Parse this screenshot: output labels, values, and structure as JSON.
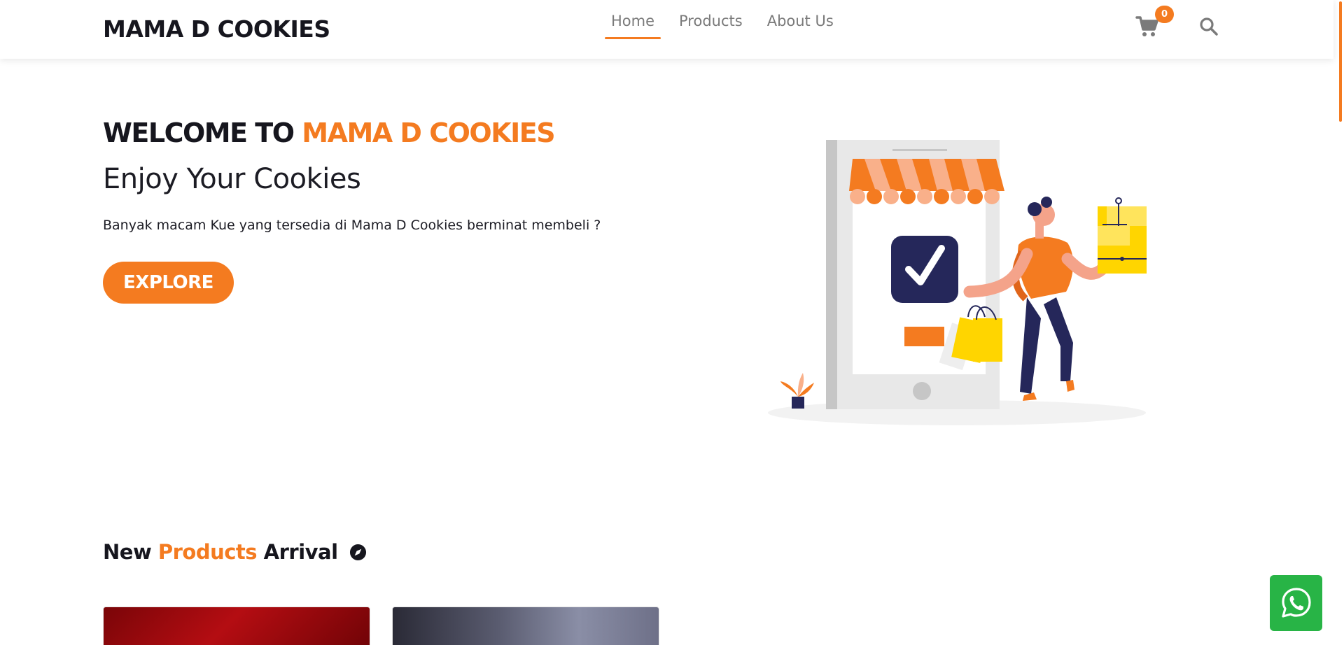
{
  "brand": "MAMA D COOKIES",
  "nav": {
    "links": [
      {
        "label": "Home",
        "active": true
      },
      {
        "label": "Products",
        "active": false
      },
      {
        "label": "About Us",
        "active": false
      }
    ]
  },
  "cart": {
    "count": "0",
    "icon": "cart-icon"
  },
  "search": {
    "icon": "search-icon"
  },
  "hero": {
    "title_prefix": "WELCOME TO",
    "title_accent": "MAMA D COOKIES",
    "subtitle": "Enjoy Your Cookies",
    "description": "Banyak macam Kue yang tersedia di Mama D Cookies berminat membeli ?",
    "button_label": "EXPLORE"
  },
  "section": {
    "title_part1": "New",
    "title_accent": "Products",
    "title_part2": "Arrival",
    "icon": "compass-icon"
  },
  "whatsapp": {
    "icon": "whatsapp-icon"
  },
  "colors": {
    "accent": "#f47b20",
    "dark": "#16161e",
    "navy": "#25275a",
    "whatsapp": "#28b446",
    "yellow": "#ffd500"
  }
}
